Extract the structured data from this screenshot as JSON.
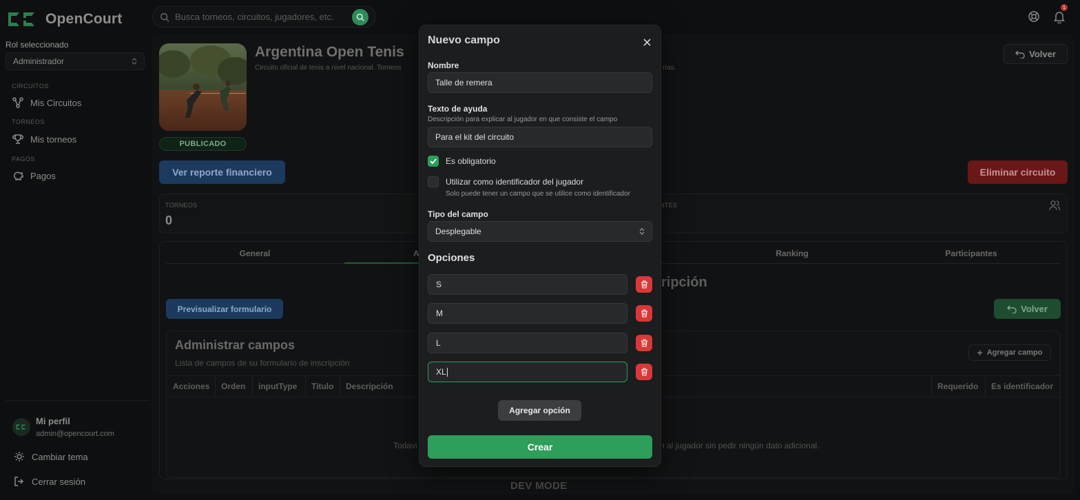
{
  "app": {
    "name": "OpenCourt"
  },
  "search": {
    "placeholder": "Busca torneos, circuitos, jugadores, etc."
  },
  "topbar": {
    "notification_count": "1"
  },
  "sidebar": {
    "role_label": "Rol seleccionado",
    "role_value": "Administrador",
    "sections": [
      {
        "title": "CIRCUITOS",
        "item": "Mis Circuitos"
      },
      {
        "title": "TORNEOS",
        "item": "Mis torneos"
      },
      {
        "title": "PAGOS",
        "item": "Pagos"
      }
    ],
    "profile": {
      "name": "Mi perfil",
      "email": "admin@opencourt.com"
    },
    "theme": "Cambiar tema",
    "logout": "Cerrar sesión"
  },
  "circuit": {
    "title": "Argentina Open Tenis",
    "description": "Circuito oficial de tenis a nivel nacional. Torneos",
    "description_tail": "rías.",
    "status": "PUBLICADO",
    "report_button": "Ver reporte financiero",
    "delete_button": "Eliminar circuito",
    "back_button": "Volver"
  },
  "stats": {
    "tournaments_label": "TORNEOS",
    "tournaments_value": "0",
    "participants_label": "NTES"
  },
  "tabs": [
    "General",
    "A",
    "Ranking",
    "Participantes"
  ],
  "form_section": {
    "title": "ripción",
    "preview_button": "Previsualizar formulario",
    "back_button": "Volver",
    "admin_title": "Administrar campos",
    "admin_subtitle": "Lista de campos de su formulario de inscripción",
    "add_field_button": "Agregar campo",
    "columns": [
      "Acciones",
      "Orden",
      "inputType",
      "Titulo",
      "Descripción",
      "Requerido",
      "Es identificador"
    ],
    "empty_left": "Todavi",
    "empty_right": "n al jugador sin pedir ningún dato adicional."
  },
  "dev_mode": "DEV MODE",
  "modal": {
    "title": "Nuevo campo",
    "name_label": "Nombre",
    "name_value": "Talle de remera",
    "help_label": "Texto de ayuda",
    "help_description": "Descripción para explicar al jugador en que consiste el campo",
    "help_value": "Para el kit del circuito",
    "required_label": "Es obligatorio",
    "required_checked": true,
    "identifier_label": "Utilizar como identificador del jugador",
    "identifier_hint": "Solo puede tener un campo que se utilice como identificador",
    "identifier_checked": false,
    "type_label": "Tipo del campo",
    "type_value": "Desplegable",
    "options_title": "Opciones",
    "options": [
      "S",
      "M",
      "L",
      "XL"
    ],
    "add_option_button": "Agregar opción",
    "create_button": "Crear"
  },
  "colors": {
    "accent": "#2e9e5b",
    "danger": "#d93838",
    "info": "#1c3a5e"
  }
}
